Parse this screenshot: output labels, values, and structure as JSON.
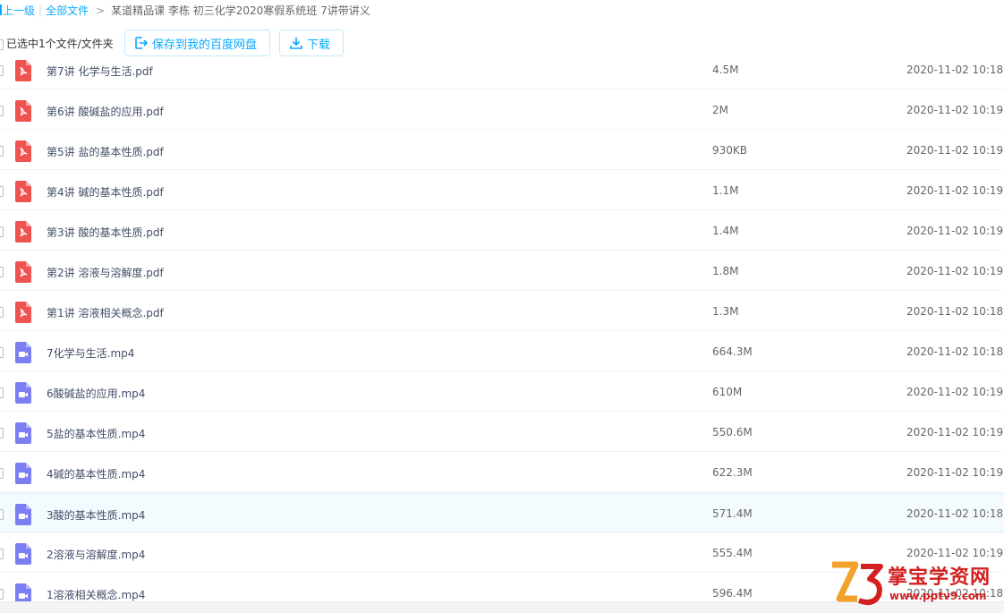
{
  "breadcrumb": {
    "back_label": "上一级",
    "all_files_label": "全部文件",
    "arrow": ">",
    "current_folder": "某道精品课 李栋 初三化学2020寒假系统班 7讲带讲义"
  },
  "toolbar": {
    "selection_text": "已选中1个文件/文件夹",
    "save_label": "保存到我的百度网盘",
    "download_label": "下载"
  },
  "colors": {
    "accent": "#09aaff",
    "pdf": "#ef5350",
    "video": "#7c7ff2",
    "watermark": "#d22020"
  },
  "files": [
    {
      "name": "第7讲 化学与生活.pdf",
      "size": "4.5M",
      "date": "2020-11-02 10:18",
      "icon": "pdf-icon"
    },
    {
      "name": "第6讲 酸碱盐的应用.pdf",
      "size": "2M",
      "date": "2020-11-02 10:19",
      "icon": "pdf-icon"
    },
    {
      "name": "第5讲 盐的基本性质.pdf",
      "size": "930KB",
      "date": "2020-11-02 10:19",
      "icon": "pdf-icon"
    },
    {
      "name": "第4讲 碱的基本性质.pdf",
      "size": "1.1M",
      "date": "2020-11-02 10:19",
      "icon": "pdf-icon"
    },
    {
      "name": "第3讲 酸的基本性质.pdf",
      "size": "1.4M",
      "date": "2020-11-02 10:19",
      "icon": "pdf-icon"
    },
    {
      "name": "第2讲 溶液与溶解度.pdf",
      "size": "1.8M",
      "date": "2020-11-02 10:19",
      "icon": "pdf-icon"
    },
    {
      "name": "第1讲 溶液相关概念.pdf",
      "size": "1.3M",
      "date": "2020-11-02 10:18",
      "icon": "pdf-icon"
    },
    {
      "name": "7化学与生活.mp4",
      "size": "664.3M",
      "date": "2020-11-02 10:18",
      "icon": "video-icon"
    },
    {
      "name": "6酸碱盐的应用.mp4",
      "size": "610M",
      "date": "2020-11-02 10:19",
      "icon": "video-icon"
    },
    {
      "name": "5盐的基本性质.mp4",
      "size": "550.6M",
      "date": "2020-11-02 10:19",
      "icon": "video-icon"
    },
    {
      "name": "4碱的基本性质.mp4",
      "size": "622.3M",
      "date": "2020-11-02 10:19",
      "icon": "video-icon"
    },
    {
      "name": "3酸的基本性质.mp4",
      "size": "571.4M",
      "date": "2020-11-02 10:18",
      "icon": "video-icon",
      "highlighted": true
    },
    {
      "name": "2溶液与溶解度.mp4",
      "size": "555.4M",
      "date": "2020-11-02 10:19",
      "icon": "video-icon"
    },
    {
      "name": "1溶液相关概念.mp4",
      "size": "596.4M",
      "date": "2020-11-02 10:18",
      "icon": "video-icon"
    }
  ],
  "watermark": {
    "logo_mark": "Z3",
    "site_name": "掌宝学资网",
    "url": "www.pptv9.com"
  }
}
